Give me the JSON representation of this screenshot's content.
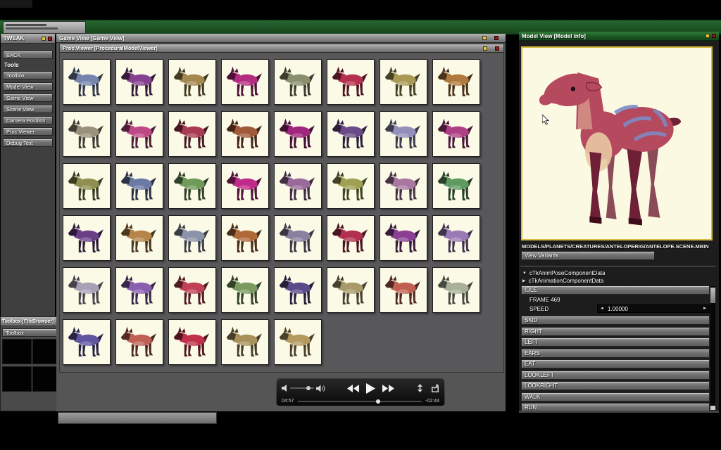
{
  "colors": {
    "accent-yellow": "#e4c23a",
    "accent-red": "#8f1f1f",
    "green-title": "#2f7e39",
    "viewport-bg": "#fcf9e2",
    "viewport-border": "#d9bb3f",
    "cell-bg": "#fbfae6",
    "model-c1": "#b5495e",
    "model-c2": "#6e2136",
    "model-belly": "#e9c9a4",
    "model-stripe": "#7d8bc7"
  },
  "tweak": {
    "title": "TWEAK",
    "back_label": "BACK",
    "section_label": "Tools",
    "buttons": [
      "Toolbox",
      "Model View",
      "Game View",
      "Scene View",
      "Camera Position",
      "Proc Viewer",
      "Debug Text"
    ]
  },
  "toolbox": {
    "title": "Toolbox  [FileBrowser]",
    "button_label": "Toolbox"
  },
  "game_view": {
    "title": "Game View  [Game View]"
  },
  "proc_viewer": {
    "title": "Proc Viewer  [ProceduralModelViewer]",
    "creatures": [
      "#7585ad",
      "#84418f",
      "#a3894f",
      "#b52d80",
      "#8a8f6e",
      "#b5304e",
      "#a89a55",
      "#b07a3e",
      "#9a917d",
      "#c04887",
      "#a83a52",
      "#a05a3a",
      "#a0257c",
      "#6a4a88",
      "#9290bb",
      "#ad3f85",
      "#8f8f52",
      "#6a7aa5",
      "#6f9a5a",
      "#c02a88",
      "#9a6a9a",
      "#a0a055",
      "#a878a0",
      "#5f9a60",
      "#6a3f88",
      "#b5854a",
      "#8a93a8",
      "#b06a3a",
      "#8a80a0",
      "#b03050",
      "#8a3f92",
      "#9a7ab5",
      "#a8a0b5",
      "#8a5fb0",
      "#c04055",
      "#7a9a5f",
      "#5a4a8a",
      "#a89a6a",
      "#c06050",
      "#a8b098",
      "#5f55a0",
      "#c05f55",
      "#c0304a",
      "#a8925a",
      "#b59a60"
    ]
  },
  "player": {
    "elapsed": "04:57",
    "remaining": "-02:44",
    "progress_pct": 63,
    "volume_pct": 68
  },
  "model_view": {
    "title": "Model View  [Model Info]",
    "path": "MODELS/PLANETS/CREATURES/ANTELOPERIG/ANTELOPE.SCENE.MBIN",
    "variants_label": "View Variants",
    "tree": [
      {
        "caret": "▼",
        "label": "cTkAnimPoseComponentData"
      },
      {
        "caret": "▶",
        "label": "cTkAnimationComponentData"
      }
    ],
    "idle_label": "IDLE",
    "frame_label": "FRAME 469",
    "speed_label": "SPEED",
    "speed_value": "1.00000",
    "spinner_left": "◄",
    "spinner_right": "►",
    "anim_buttons": [
      "SKID",
      "RIGHT",
      "LEFT",
      "EARS",
      "EAT",
      "LOOKLEFT",
      "LOOKRIGHT",
      "WALK",
      "RUN"
    ]
  }
}
